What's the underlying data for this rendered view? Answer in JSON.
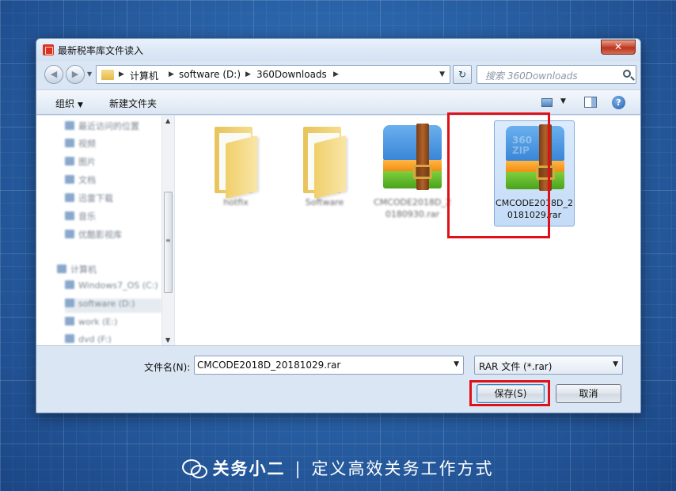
{
  "window": {
    "title": "最新税率库文件读入",
    "close_label": "✕"
  },
  "address": {
    "crumbs": [
      "计算机",
      "software (D:)",
      "360Downloads"
    ],
    "search_placeholder": "搜索 360Downloads"
  },
  "toolbar": {
    "organize": "组织",
    "new_folder": "新建文件夹"
  },
  "nav_pane": {
    "items": [
      "最近访问的位置",
      "视频",
      "图片",
      "文档",
      "迅雷下载",
      "音乐",
      "优酷影视库",
      "计算机",
      "Windows7_OS (C:)",
      "software (D:)",
      "work (E:)",
      "dvd (F:)"
    ]
  },
  "files": [
    {
      "name": "hotfix",
      "type": "folder"
    },
    {
      "name": "Software",
      "type": "folder"
    },
    {
      "name": "CMCODE2018D_20180930.rar",
      "type": "rar"
    },
    {
      "name": "CMCODE2018D_20181029.rar",
      "type": "rar",
      "selected": true
    }
  ],
  "bottom": {
    "filename_label": "文件名(N):",
    "filename_value": "CMCODE2018D_20181029.rar",
    "filter_value": "RAR 文件 (*.rar)",
    "save_label": "保存(S)",
    "cancel_label": "取消"
  },
  "footer": {
    "brand_name": "关务小二",
    "separator": "|",
    "slogan": "定义高效关务工作方式"
  },
  "colors": {
    "highlight_box": "#e01018",
    "background_blue": "#2a63a8"
  }
}
